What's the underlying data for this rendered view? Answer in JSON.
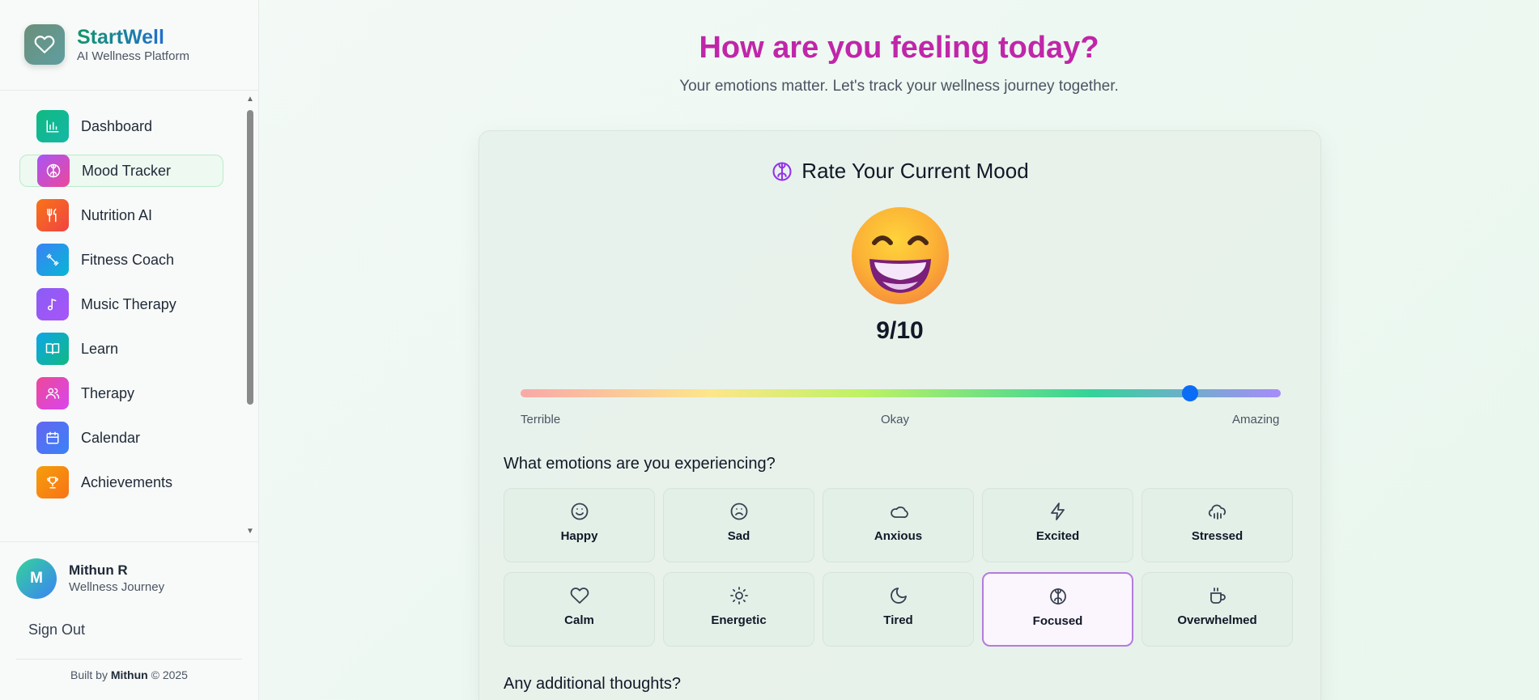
{
  "brand": {
    "name": "StartWell",
    "subtitle": "AI Wellness Platform"
  },
  "sidebar": {
    "items": [
      {
        "label": "Dashboard",
        "icon": "bar-chart-icon",
        "color": "#10b981"
      },
      {
        "label": "Mood Tracker",
        "icon": "brain-icon",
        "color": "#c026d3",
        "active": true
      },
      {
        "label": "Nutrition AI",
        "icon": "utensils-icon",
        "color": "#f97316"
      },
      {
        "label": "Fitness Coach",
        "icon": "dumbbell-icon",
        "color": "#3b82f6"
      },
      {
        "label": "Music Therapy",
        "icon": "music-note-icon",
        "color": "#8b5cf6"
      },
      {
        "label": "Learn",
        "icon": "book-icon",
        "color": "#06b6d4"
      },
      {
        "label": "Therapy",
        "icon": "users-icon",
        "color": "#ec4899"
      },
      {
        "label": "Calendar",
        "icon": "calendar-icon",
        "color": "#6366f1"
      },
      {
        "label": "Achievements",
        "icon": "trophy-icon",
        "color": "#f59e0b"
      }
    ]
  },
  "user": {
    "initial": "M",
    "name": "Mithun R",
    "subtitle": "Wellness Journey",
    "signout": "Sign Out"
  },
  "footer": {
    "prefix": "Built by",
    "author": "Mithun",
    "suffix": "© 2025"
  },
  "main": {
    "title": "How are you feeling today?",
    "subtitle": "Your emotions matter. Let's track your wellness journey together."
  },
  "mood": {
    "card_title": "Rate Your Current Mood",
    "score": "9/10",
    "value": 9,
    "max": 10,
    "scale": {
      "low": "Terrible",
      "mid": "Okay",
      "high": "Amazing"
    },
    "emotions_heading": "What emotions are you experiencing?",
    "emotions": [
      {
        "label": "Happy",
        "icon": "smile-icon"
      },
      {
        "label": "Sad",
        "icon": "frown-icon"
      },
      {
        "label": "Anxious",
        "icon": "cloud-icon"
      },
      {
        "label": "Excited",
        "icon": "lightning-icon"
      },
      {
        "label": "Stressed",
        "icon": "cloud-rain-icon"
      },
      {
        "label": "Calm",
        "icon": "heart-icon"
      },
      {
        "label": "Energetic",
        "icon": "sun-icon"
      },
      {
        "label": "Tired",
        "icon": "moon-icon"
      },
      {
        "label": "Focused",
        "icon": "brain-icon",
        "selected": true
      },
      {
        "label": "Overwhelmed",
        "icon": "coffee-icon"
      }
    ],
    "thoughts_heading": "Any additional thoughts?"
  }
}
